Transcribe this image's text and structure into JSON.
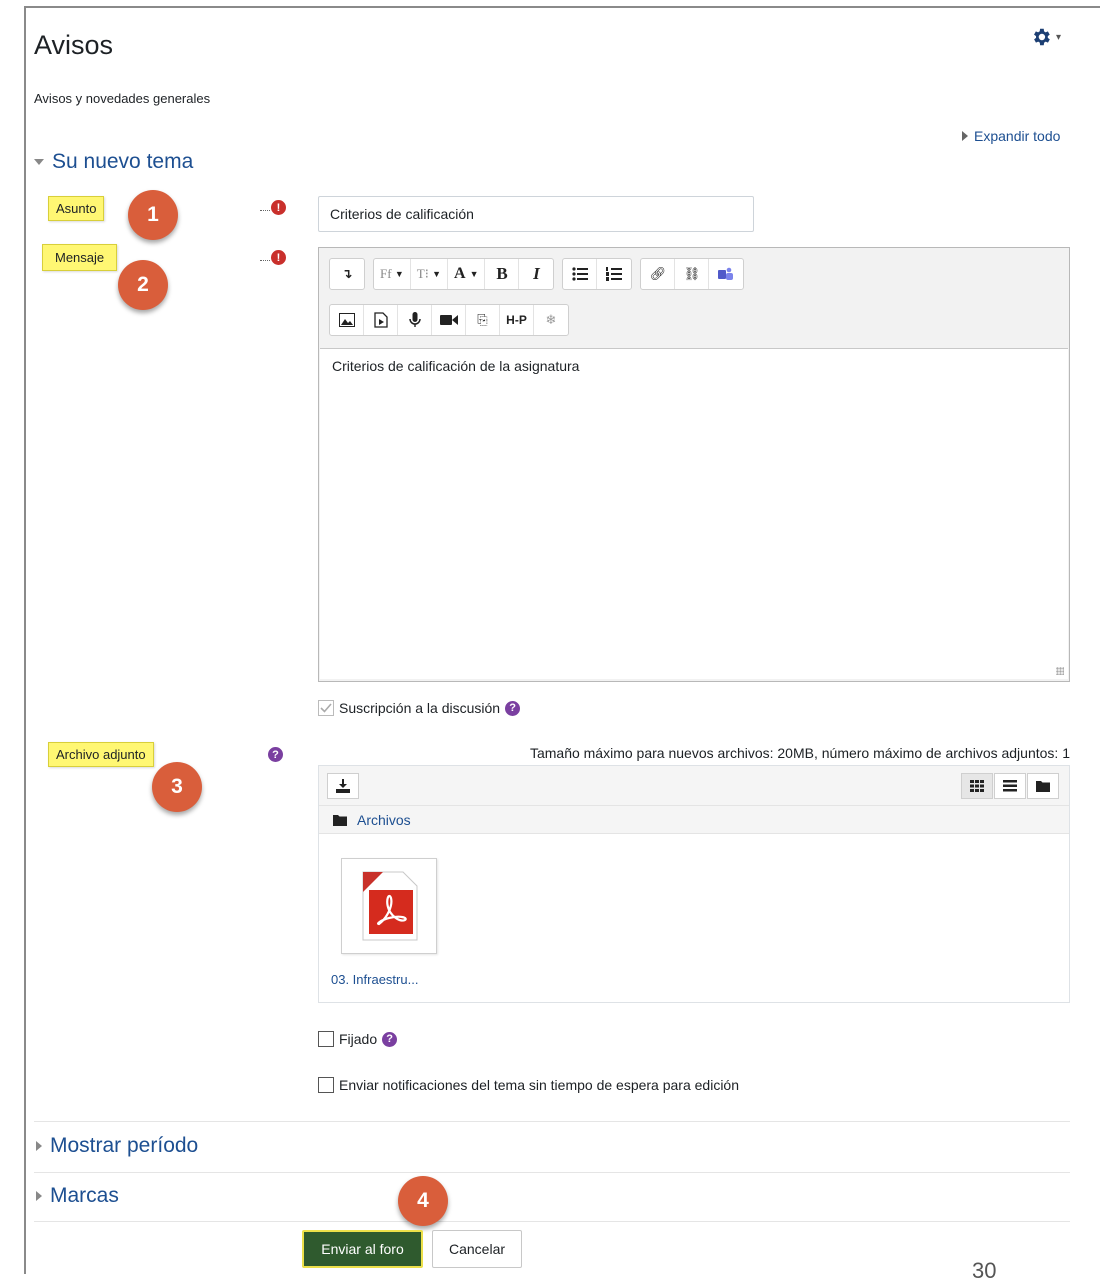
{
  "header": {
    "title": "Avisos",
    "description": "Avisos y novedades generales",
    "expand_all": "Expandir todo"
  },
  "section_new_topic": {
    "title": "Su nuevo tema"
  },
  "fields": {
    "subject": {
      "label": "Asunto",
      "value": "Criterios de calificación",
      "badge": "1"
    },
    "message": {
      "label": "Mensaje",
      "content": "Criterios de calificación de la asignatura",
      "badge": "2"
    },
    "subscription": {
      "label": "Suscripción a la discusión",
      "checked": true
    },
    "attachment": {
      "label": "Archivo adjunto",
      "badge": "3",
      "max_info": "Tamaño máximo para nuevos archivos: 20MB, número máximo de archivos adjuntos: 1"
    },
    "pinned": {
      "label": "Fijado",
      "checked": false
    },
    "notify": {
      "label": "Enviar notificaciones del tema sin tiempo de espera para edición",
      "checked": false
    }
  },
  "editor_toolbar": {
    "row1": [
      [
        "toggle-toolbar-icon"
      ],
      [
        "font-family-icon",
        "font-size-icon",
        "font-color-icon",
        "bold-icon",
        "italic-icon"
      ],
      [
        "unordered-list-icon",
        "ordered-list-icon"
      ],
      [
        "link-icon",
        "unlink-icon",
        "teams-icon"
      ]
    ],
    "row2": [
      "image-icon",
      "media-icon",
      "record-audio-icon",
      "record-video-icon",
      "manage-files-icon",
      "h5p-icon",
      "equation-icon"
    ],
    "labels": {
      "font_family": "Ff",
      "font_size": "T",
      "font_color": "A",
      "bold": "B",
      "italic": "I",
      "h5p": "H-P"
    }
  },
  "file_manager": {
    "path_label": "Archivos",
    "files": [
      {
        "name": "03. Infraestru..."
      }
    ]
  },
  "collapsed_sections": [
    {
      "title": "Mostrar período"
    },
    {
      "title": "Marcas"
    }
  ],
  "actions": {
    "submit": "Enviar al foro",
    "cancel": "Cancelar",
    "badge": "4"
  },
  "page_number": "30",
  "icons": {
    "gear": "gear-icon",
    "required": "exclamation-icon",
    "help": "question-icon"
  },
  "colors": {
    "accent": "#1d4f91",
    "badge": "#d95e3b",
    "highlight": "#fff773",
    "submit_bg": "#2f5a2e",
    "required": "#c9302c",
    "help": "#7a3fa0"
  }
}
